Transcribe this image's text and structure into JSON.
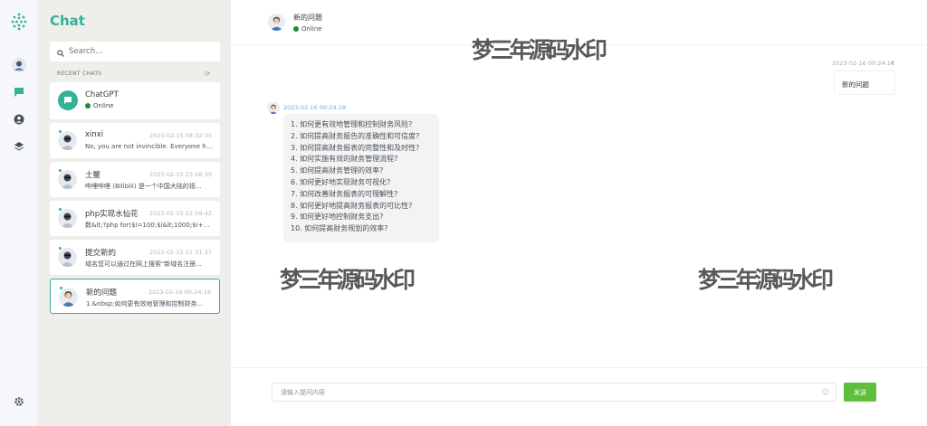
{
  "rail": {
    "icons": [
      "logo-icon",
      "avatar-icon",
      "chat-icon",
      "profile-icon",
      "layers-icon",
      "settings-icon"
    ]
  },
  "sidebar": {
    "title": "Chat",
    "search_placeholder": "Search...",
    "recent_header": "RECENT CHATS",
    "chats": [
      {
        "name": "ChatGPT",
        "status": "Online"
      },
      {
        "name": "xinxi",
        "time": "2023-02-15 08:32:35",
        "preview": "No, you are not invincible. Everyone has..."
      },
      {
        "name": "土鳖",
        "time": "2023-02-15 23:08:35",
        "preview": "哔哩哔哩 (Bilibili) 是一个中国大陆的视..."
      },
      {
        "name": "php实现水仙花",
        "time": "2023-02-15 22:59:42",
        "preview": "数&lt;?php for($i=100;$i&lt;1000;$i++)..."
      },
      {
        "name": "提交新的",
        "time": "2023-02-15 21:31:37",
        "preview": "域名您可以通过在网上搜索\"新域名注册..."
      },
      {
        "name": "新的问题",
        "time": "2023-02-16 00:24:18",
        "preview": "1.&nbsp;如何更有效地管理和控制财务..."
      }
    ]
  },
  "main": {
    "header": {
      "name": "新的问题",
      "status": "Online"
    },
    "watermark": "梦三年源码水印",
    "outgoing": {
      "time": "2023-02-16 00:24:18",
      "text": "新的问题"
    },
    "incoming": {
      "time": "2023-02-16 00:24:18",
      "lines": [
        "1. 如何更有效地管理和控制财务风险?",
        "2. 如何提高财务报告的准确性和可信度?",
        "3. 如何提高财务报表的完整性和及时性?",
        "4. 如何实施有效的财务管理流程?",
        "5. 如何提高财务管理的效率?",
        "6. 如何更好地实现财务可视化?",
        "7. 如何改善财务报表的可理解性?",
        "8. 如何更好地提高财务报表的可比性?",
        "9. 如何更好地控制财务支出?",
        "10. 如何提高财务规划的效率?"
      ]
    },
    "composer": {
      "placeholder": "请输入提问内容",
      "send_label": "发送"
    }
  },
  "colors": {
    "accent": "#35b19a",
    "online": "#1b8a3b",
    "send": "#5fbf3b"
  }
}
